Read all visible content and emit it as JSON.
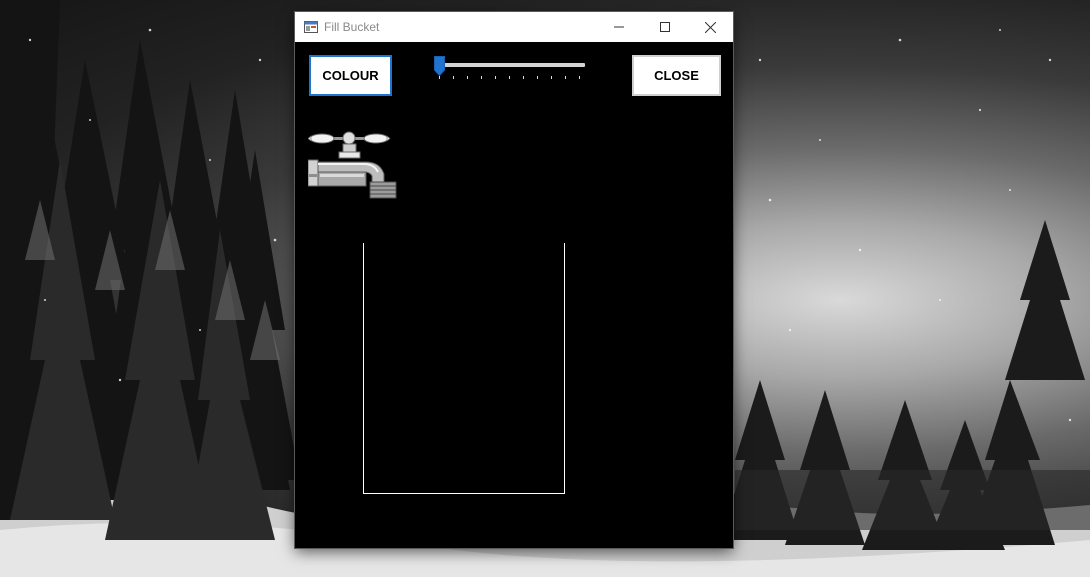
{
  "window": {
    "title": "Fill Bucket",
    "controls": [
      "minimize",
      "maximize",
      "close"
    ]
  },
  "toolbar": {
    "colour_label": "COLOUR",
    "close_label": "CLOSE"
  },
  "slider": {
    "min": 0,
    "max": 10,
    "value": 0,
    "tick_count": 11
  },
  "bucket": {
    "fill_fraction": 0,
    "fill_color": "#1e74d0"
  },
  "icons": {
    "app": "app-window-icon",
    "faucet": "faucet-icon"
  },
  "colors": {
    "accent": "#1e74d0",
    "window_background": "#000000",
    "titlebar": "#ffffff"
  }
}
